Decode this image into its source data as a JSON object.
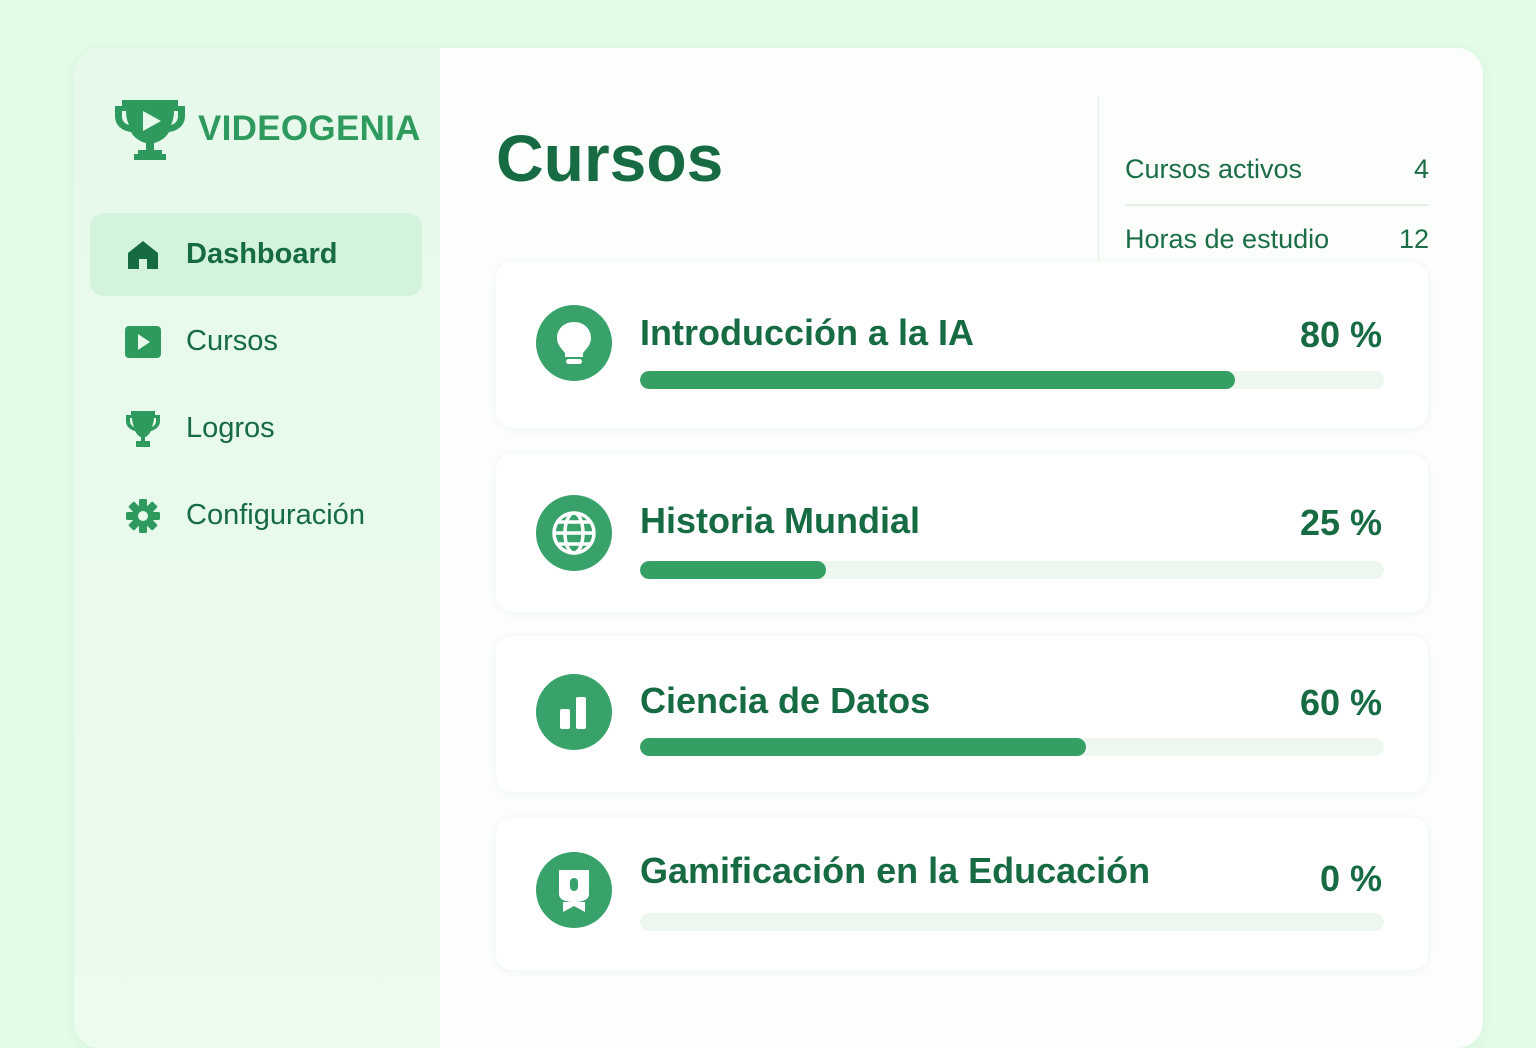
{
  "brand": {
    "name": "VIDEOGENIA",
    "logo_icon": "trophy-play-icon"
  },
  "sidebar": {
    "items": [
      {
        "label": "Dashboard",
        "icon": "home-icon",
        "active": true
      },
      {
        "label": "Cursos",
        "icon": "play-square-icon",
        "active": false
      },
      {
        "label": "Logros",
        "icon": "trophy-icon",
        "active": false
      },
      {
        "label": "Configuración",
        "icon": "gear-icon",
        "active": false
      }
    ]
  },
  "main": {
    "title": "Cursos",
    "stats": [
      {
        "label": "Cursos activos",
        "value": "4"
      },
      {
        "label": "Horas de estudio",
        "value": "12"
      }
    ],
    "courses": [
      {
        "title": "Introducción a la IA",
        "percent_label": "80 %",
        "progress": 0.8,
        "icon": "lightbulb-icon"
      },
      {
        "title": "Historia Mundial",
        "percent_label": "25 %",
        "progress": 0.25,
        "icon": "globe-icon"
      },
      {
        "title": "Ciencia de Datos",
        "percent_label": "60 %",
        "progress": 0.6,
        "icon": "bar-chart-icon"
      },
      {
        "title": "Gamificación en la Educación",
        "percent_label": "0 %",
        "progress": 0,
        "icon": "badge-icon"
      }
    ]
  },
  "colors": {
    "background": "#e3fbe7",
    "accent": "#38a26a",
    "text": "#176b43",
    "active_nav": "#d3f3dc",
    "track": "#eef7ef"
  }
}
